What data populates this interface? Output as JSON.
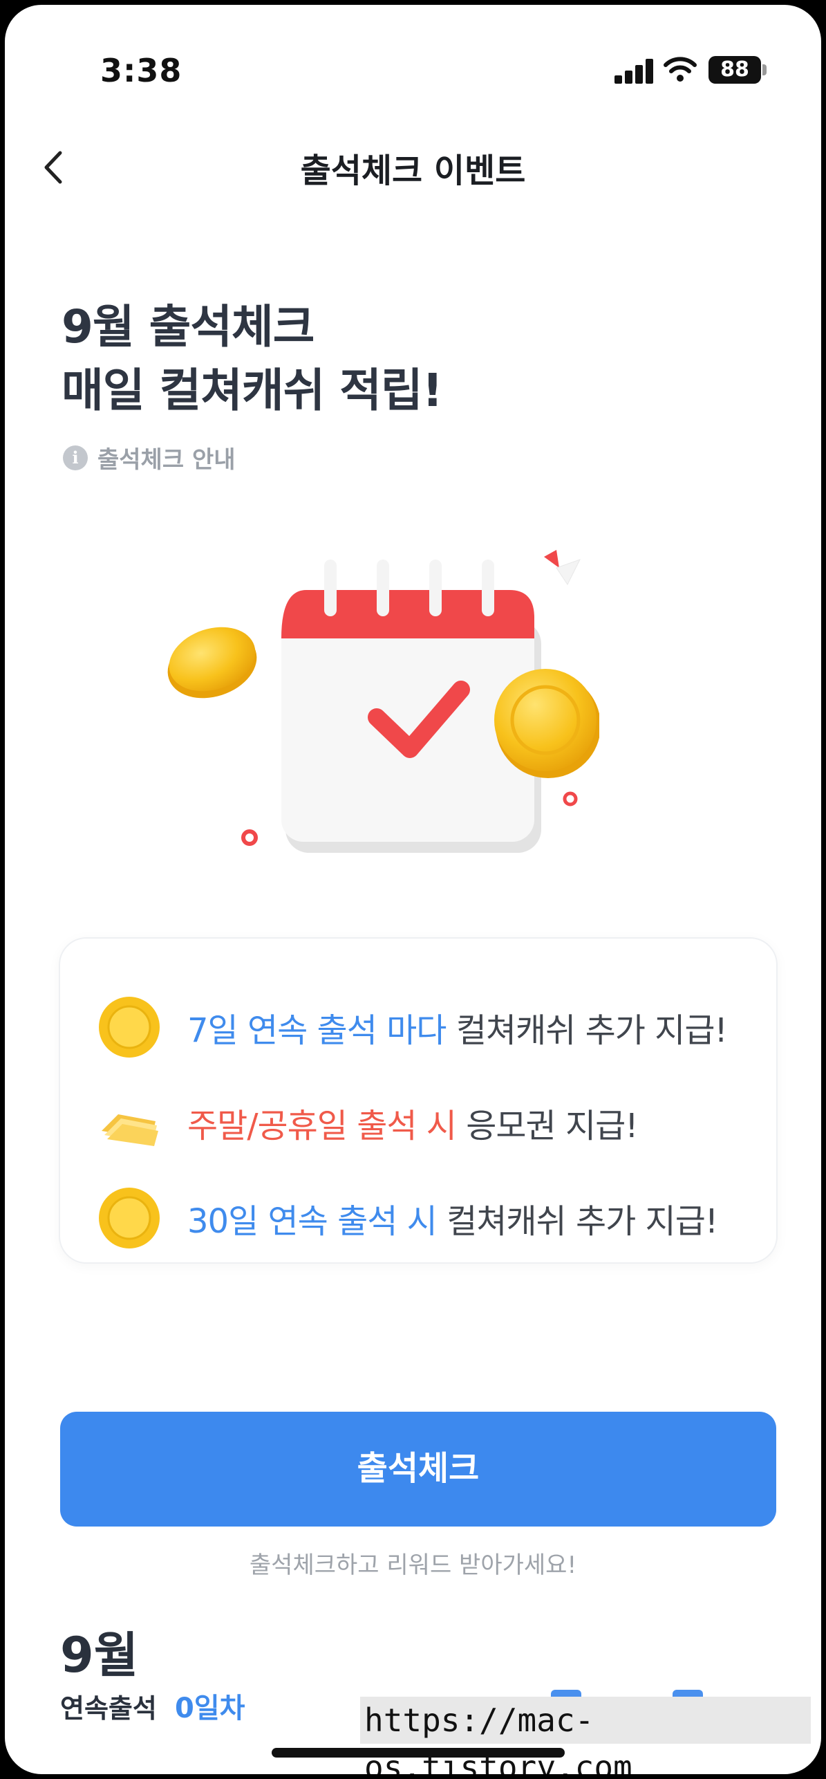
{
  "status_bar": {
    "time": "3:38",
    "battery": "88"
  },
  "nav": {
    "title": "출석체크 이벤트"
  },
  "headline": {
    "line1": "9월 출석체크",
    "line2": "매일 컬쳐캐쉬 적립!"
  },
  "info_link": {
    "icon": "i",
    "label": "출석체크 안내"
  },
  "benefits": [
    {
      "icon": "coin-icon",
      "highlight": "7일 연속 출석 마다",
      "text": " 컬쳐캐쉬 추가 지급!",
      "color": "#3f8bed"
    },
    {
      "icon": "ticket-icon",
      "highlight": "주말/공휴일 출석 시",
      "text": " 응모권 지급!",
      "color": "#f05a4a"
    },
    {
      "icon": "coin-icon",
      "highlight": "30일 연속 출석 시",
      "text": " 컬쳐캐쉬 추가 지급!",
      "color": "#3f8bed"
    }
  ],
  "cta": {
    "label": "출석체크",
    "subtext": "출석체크하고 리워드 받아가세요!"
  },
  "calendar_section": {
    "month": "9월",
    "streak_label": "연속출석",
    "streak_value": "0일차"
  },
  "watermark": "https://mac-os.tistory.com",
  "colors": {
    "accent": "#3d89ee",
    "highlight_blue": "#3f8bed",
    "highlight_red": "#f05a4a",
    "calendar_red": "#f0484a",
    "coin_gold": "#f8c21c"
  }
}
